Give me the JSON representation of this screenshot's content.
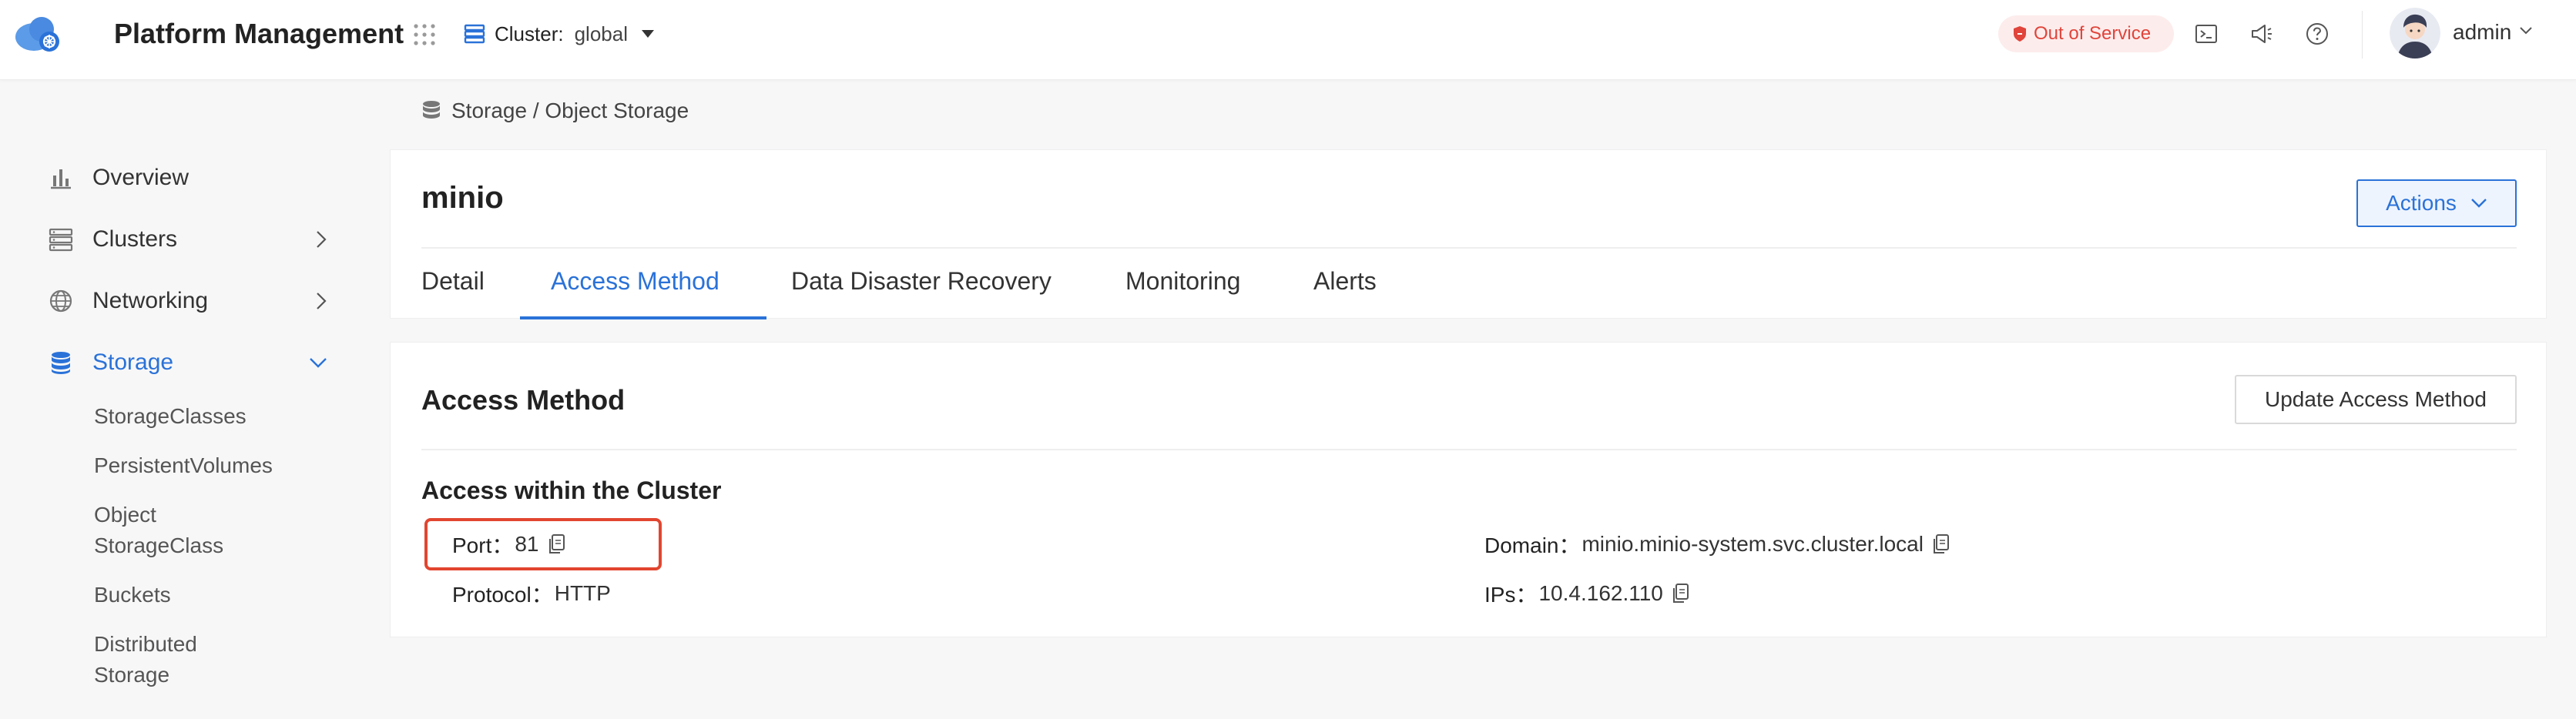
{
  "topbar": {
    "app_title": "Platform Management",
    "cluster_label": "Cluster:",
    "cluster_value": "global",
    "status_text": "Out of Service",
    "user_name": "admin"
  },
  "sidebar": {
    "items": [
      {
        "label": "Overview"
      },
      {
        "label": "Clusters"
      },
      {
        "label": "Networking"
      },
      {
        "label": "Storage"
      }
    ],
    "sub_items": [
      {
        "label": "StorageClasses"
      },
      {
        "label": "PersistentVolumes"
      },
      {
        "label_line1": "Object",
        "label_line2": "StorageClass"
      },
      {
        "label": "Buckets"
      },
      {
        "label_line1": "Distributed",
        "label_line2": "Storage"
      }
    ]
  },
  "breadcrumb": {
    "text": "Storage / Object Storage"
  },
  "resource": {
    "name": "minio",
    "actions_label": "Actions",
    "tabs": [
      {
        "label": "Detail"
      },
      {
        "label": "Access Method"
      },
      {
        "label": "Data Disaster Recovery"
      },
      {
        "label": "Monitoring"
      },
      {
        "label": "Alerts"
      }
    ],
    "active_tab": "Access Method"
  },
  "access": {
    "section_title": "Access Method",
    "update_label": "Update Access Method",
    "sub_title": "Access within the Cluster",
    "port_key": "Port：",
    "port_value": "81",
    "protocol_key": "Protocol：",
    "protocol_value": "HTTP",
    "domain_key": "Domain：",
    "domain_value": "minio.minio-system.svc.cluster.local",
    "ips_key": "IPs：",
    "ips_value": "10.4.162.110"
  },
  "colors": {
    "accent": "#2a72d8",
    "danger": "#e0443a",
    "highlight": "#e2452f"
  }
}
